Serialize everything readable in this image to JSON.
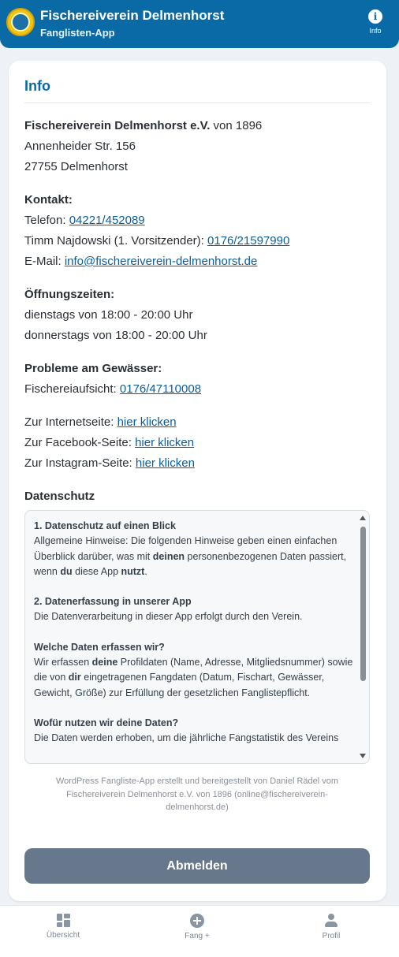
{
  "header": {
    "title": "Fischereiverein Delmenhorst",
    "subtitle": "Fanglisten-App",
    "info_label": "Info",
    "info_icon": "info-icon",
    "accent_color": "#0a6aa5"
  },
  "card": {
    "title": "Info",
    "club_name": "Fischereiverein Delmenhorst e.V.",
    "club_founded": " von 1896",
    "street": "Annenheider Str. 156",
    "city": "27755 Delmenhorst",
    "contact_heading": "Kontakt:",
    "phone_label": "Telefon: ",
    "phone_value": "04221/452089",
    "chair_label": "Timm Najdowski (1. Vorsitzender): ",
    "chair_value": "0176/21597990",
    "email_label": "E-Mail: ",
    "email_value": "info@fischereiverein-delmenhorst.de",
    "hours_heading": "Öffnungszeiten:",
    "hours_line1": "dienstags von 18:00 - 20:00 Uhr",
    "hours_line2": "donnerstags von 18:00 - 20:00 Uhr",
    "problems_heading": "Probleme am Gewässer:",
    "supervision_label": "Fischereiaufsicht: ",
    "supervision_value": "0176/47110008",
    "web_label": "Zur Internetseite: ",
    "facebook_label": "Zur Facebook-Seite: ",
    "instagram_label": "Zur Instagram-Seite: ",
    "link_text": "hier klicken",
    "privacy_heading": "Datenschutz"
  },
  "privacy": {
    "s1_title": "1. Datenschutz auf einen Blick",
    "s1_a": "Allgemeine Hinweise: Die folgenden Hinweise geben einen einfachen Überblick darüber, was mit ",
    "s1_b": "deinen",
    "s1_c": " personenbezogenen Daten passiert, wenn ",
    "s1_d": "du",
    "s1_e": " diese App ",
    "s1_f": "nutzt",
    "s1_g": ".",
    "s2_title": "2. Datenerfassung in unserer App",
    "s2_text": "Die Datenverarbeitung in dieser App erfolgt durch den Verein.",
    "s3_title": "Welche Daten erfassen wir?",
    "s3_a": "Wir erfassen ",
    "s3_b": "deine",
    "s3_c": " Profildaten (Name, Adresse, Mitgliedsnummer) sowie die von ",
    "s3_d": "dir",
    "s3_e": " eingetragenen Fangdaten (Datum, Fischart, Gewässer, Gewicht, Größe) zur Erfüllung der gesetzlichen Fanglistepflicht.",
    "s4_title": "Wofür nutzen wir deine Daten?",
    "s4_text": "Die Daten werden erhoben, um die jährliche Fangstatistik des Vereins"
  },
  "footer": {
    "note": "WordPress Fangliste-App erstellt und bereitgestellt von Daniel Rädel vom Fischereiverein Delmenhorst e.V. von 1896 (online@fischereiverein-delmenhorst.de)",
    "logout_label": "Abmelden",
    "logout_color": "#68788c"
  },
  "nav": {
    "overview_label": "Übersicht",
    "catch_label": "Fang +",
    "profile_label": "Profil",
    "overview_icon": "dashboard-grid-icon",
    "catch_icon": "plus-circle-icon",
    "profile_icon": "user-icon"
  }
}
